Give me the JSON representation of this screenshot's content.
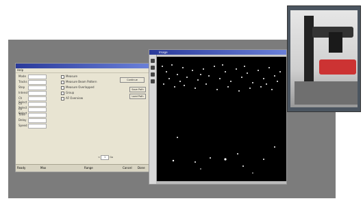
{
  "dialog": {
    "title": "",
    "menu": "Help",
    "fields": [
      {
        "label": "Mode",
        "value": ""
      },
      {
        "label": "Tracks",
        "value": ""
      },
      {
        "label": "Step",
        "value": ""
      },
      {
        "label": "Intensity",
        "value": ""
      },
      {
        "label": "Ch Select",
        "value": ""
      },
      {
        "label": "Ch Select",
        "value": ""
      },
      {
        "label": "Ch Select",
        "value": ""
      },
      {
        "label": "Time",
        "value": ""
      },
      {
        "label": "Delay",
        "value": ""
      },
      {
        "label": "Speed",
        "value": ""
      }
    ],
    "checks": [
      "Measure",
      "Measure Beam Pattern",
      "Measure Overlapped",
      "Group",
      "AF Overview"
    ],
    "buttons": [
      "Continue",
      "Save Path",
      "Load Path"
    ],
    "pager": {
      "prev": "<",
      "value": "1",
      "next": "Go"
    },
    "status": [
      "Ready",
      "Max",
      "Range",
      "Cancel",
      "Done"
    ]
  },
  "viewer": {
    "title": "Image"
  }
}
